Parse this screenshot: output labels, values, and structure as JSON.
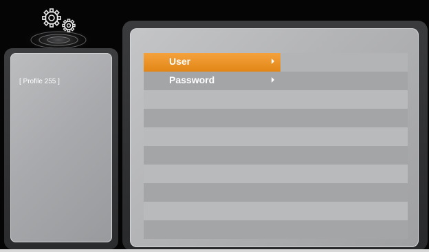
{
  "left_panel": {
    "profile_label": "[ Profile 255 ]"
  },
  "settings_icon": "gears-icon",
  "menu": {
    "items": [
      {
        "label": "User",
        "selected": true
      },
      {
        "label": "Password",
        "selected": false
      }
    ],
    "empty_rows": 8
  },
  "colors": {
    "selection": "#e8901f",
    "panel_light": "#b9babb",
    "panel_dark": "#a4a5a7",
    "text": "#ffffff"
  }
}
